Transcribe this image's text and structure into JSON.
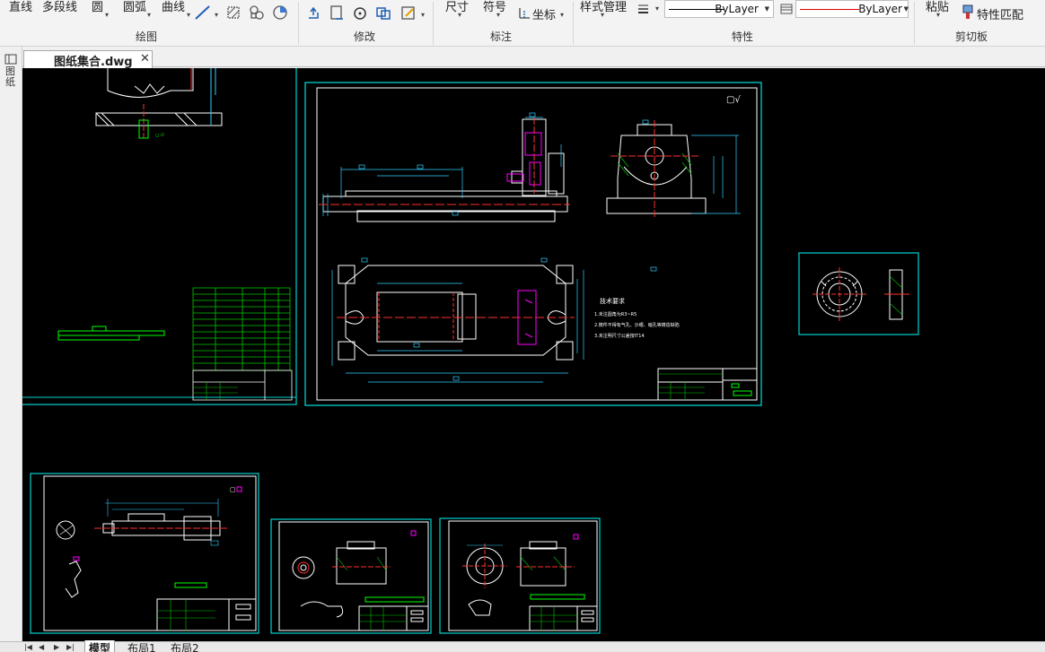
{
  "ribbon": {
    "draw": {
      "line": "直线",
      "polyline": "多段线",
      "circle": "圆",
      "arc": "圆弧",
      "curve": "曲线",
      "group_label": "绘图"
    },
    "modify": {
      "group_label": "修改"
    },
    "annotate": {
      "dimension": "尺寸",
      "symbol": "符号",
      "coordinate": "坐标",
      "group_label": "标注"
    },
    "properties": {
      "style_manager": "样式管理",
      "linetype": "ByLayer",
      "color": "ByLayer",
      "group_label": "特性"
    },
    "clipboard": {
      "paste": "粘贴",
      "match_properties": "特性匹配",
      "group_label": "剪切板"
    },
    "colors": {
      "linetype_line": "#000000",
      "color_line": "#e00000"
    }
  },
  "document": {
    "filename": "图纸集合.dwg",
    "close_glyph": "✕"
  },
  "left_panel": {
    "label": "图纸"
  },
  "layout_tabs": [
    "模型",
    "布局1",
    "布局2"
  ],
  "active_layout": "模型",
  "drawing": {
    "tech_title": "技术要求",
    "tech_lines": [
      "1.未注圆角为R3~R5",
      "2.铸件不得有气孔、沙眼、缩孔等铸造缺陷",
      "3.未注明尺寸公差按IT14"
    ],
    "roughness_mark": "▢√"
  },
  "canvas_colors": {
    "background": "#000000",
    "frame": "#00d2d2",
    "outline": "#ffffff",
    "center": "#ff3030",
    "dimension": "#30d0ff",
    "hatch": "#00c800",
    "magenta": "#ff00ff",
    "title_green": "#00ff00"
  }
}
